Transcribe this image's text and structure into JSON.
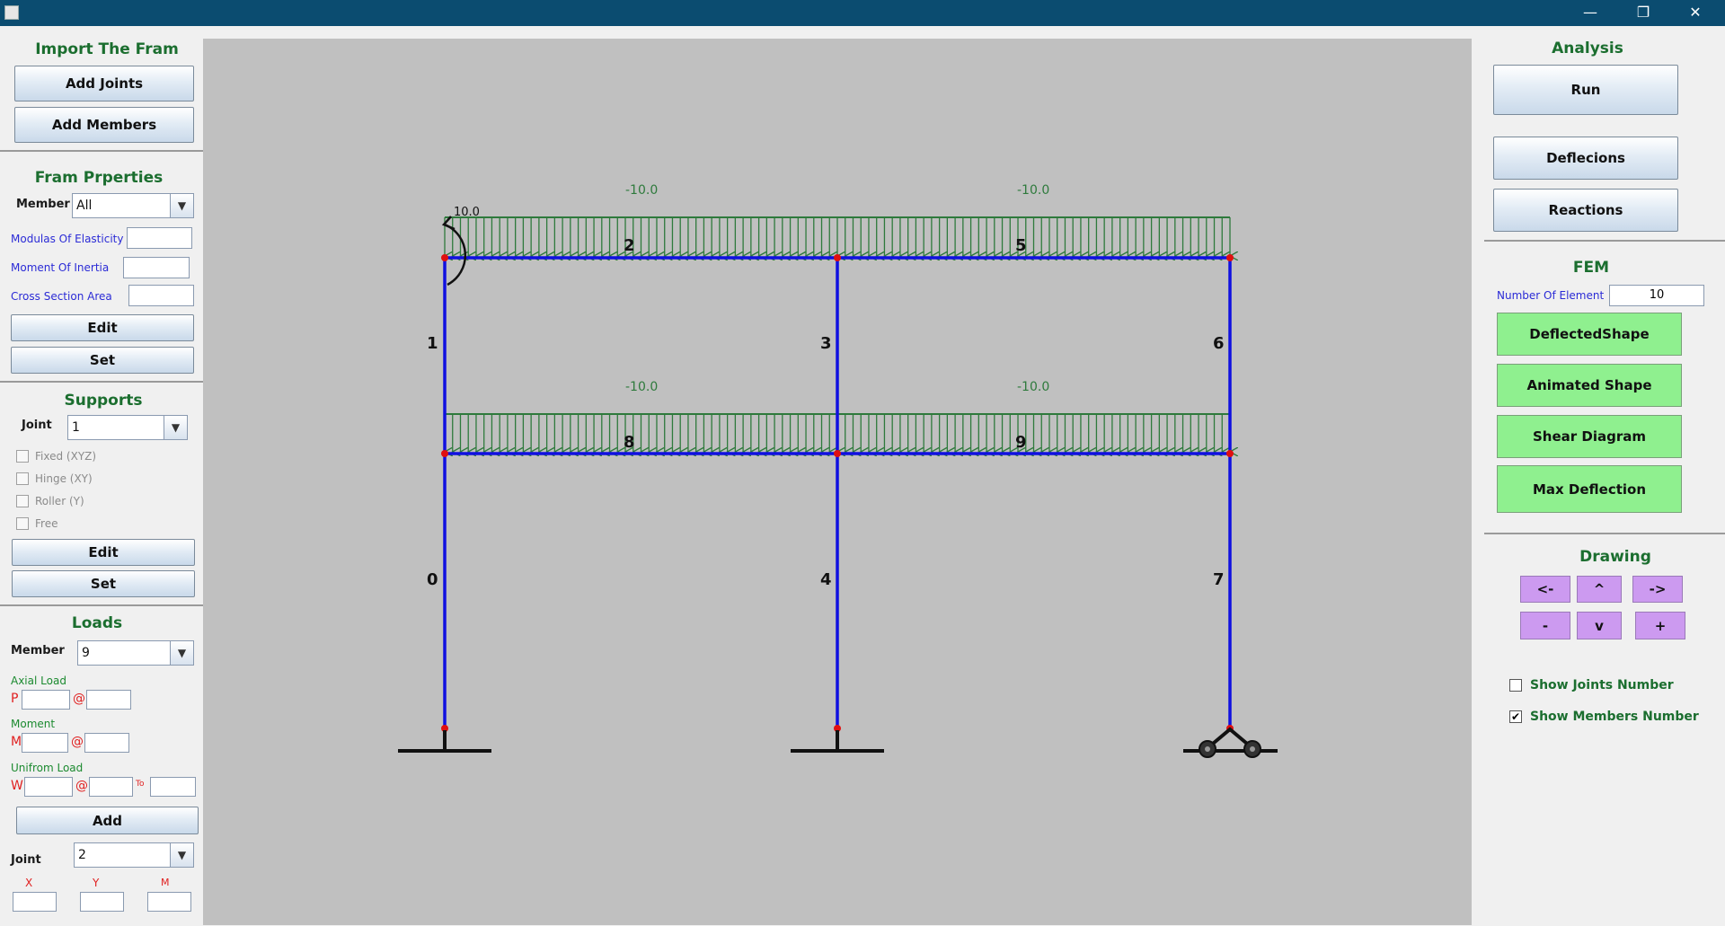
{
  "window": {
    "minimize": "—",
    "restore": "❐",
    "close": "✕"
  },
  "left": {
    "import": {
      "title": "Import The Fram",
      "add_joints": "Add Joints",
      "add_members": "Add Members"
    },
    "properties": {
      "title": "Fram Prperties",
      "member_label": "Member",
      "member_value": "All",
      "modulus_label": "Modulas Of Elasticity",
      "inertia_label": "Moment Of Inertia",
      "area_label": "Cross Section Area",
      "edit": "Edit",
      "set": "Set"
    },
    "supports": {
      "title": "Supports",
      "joint_label": "Joint",
      "joint_value": "1",
      "options": [
        "Fixed (XYZ)",
        "Hinge (XY)",
        "Roller (Y)",
        "Free"
      ],
      "edit": "Edit",
      "set": "Set"
    },
    "loads": {
      "title": "Loads",
      "member_label": "Member",
      "member_value": "9",
      "axial_label": "Axial Load",
      "axial_p": "P",
      "at": "@",
      "moment_label": "Moment",
      "moment_m": "M",
      "uniform_label": "Unifrom Load",
      "uniform_w": "W",
      "to": "To",
      "add": "Add",
      "joint_label": "Joint",
      "joint_value": "2",
      "x": "X",
      "y": "Y",
      "m": "M"
    }
  },
  "right": {
    "analysis": {
      "title": "Analysis",
      "run": "Run",
      "deflections": "Deflecions",
      "reactions": "Reactions"
    },
    "fem": {
      "title": "FEM",
      "elements_label": "Number Of Element",
      "elements_value": "10",
      "deflected_shape": "DeflectedShape",
      "animated_shape": "Animated Shape",
      "shear_diagram": "Shear Diagram",
      "max_deflection": "Max Deflection"
    },
    "drawing": {
      "title": "Drawing",
      "left": "<-",
      "up": "^",
      "right": "->",
      "zoom_out": "-",
      "down": "v",
      "zoom_in": "+",
      "show_joints": "Show Joints Number",
      "show_joints_checked": false,
      "show_members": "Show Members Number",
      "show_members_checked": true
    }
  },
  "model": {
    "member_numbers": [
      "0",
      "1",
      "2",
      "3",
      "4",
      "5",
      "6",
      "7",
      "8",
      "9"
    ],
    "upper_loads": [
      "-10.0",
      "-10.0"
    ],
    "lower_loads": [
      "-10.0",
      "-10.0"
    ],
    "moment_value": "10.0",
    "colors": {
      "member": "#1010e0",
      "load": "#2e7a3c",
      "joint": "#e01010",
      "canvas": "#c0c0c0"
    }
  }
}
